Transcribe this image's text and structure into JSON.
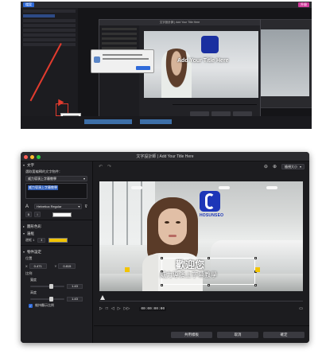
{
  "top_screenshot": {
    "tag": "檔案",
    "right_button": "升級",
    "dialog_title": "文字設計師 | Add Your Title Here",
    "stage_title": "Add Your Title Here",
    "alert_button": "確定"
  },
  "window": {
    "title": "文字設計師 | Add Your Title Here"
  },
  "left_panel": {
    "section_text": "文字",
    "prompt_label": "選取要編輯的文字物件：",
    "object_select": "威力導演上字幕教學",
    "text_content": "威力導演上字幕教學",
    "font_name": "Helvetica Regular",
    "bold_label": "B",
    "italic_label": "I",
    "font_color": "#ffffff",
    "section_fill": "圖形色彩",
    "section_border": "邊框",
    "border_label": "邊框 1",
    "border_color": "#f2c400",
    "section_object": "物件設定",
    "position_label": "位置",
    "x_label": "X",
    "x_value": "0.471",
    "y_label": "Y",
    "y_value": "0.815",
    "scale_label": "比例",
    "width_label": "寬度",
    "width_value": "1.43",
    "width_fraction": 0.55,
    "height_label": "高度",
    "height_value": "1.43",
    "height_fraction": 0.55,
    "keep_ratio_label": "維持顯示比例"
  },
  "right_panel": {
    "zoom_value": "檢視大小",
    "logo_text": "HOSUNSEO",
    "title_line1": "歡迎您",
    "title_line2": "威力導演上字幕教學",
    "timecode": "00:00:00:00"
  },
  "footer": {
    "share_button": "共用樣板",
    "cancel_button": "取消",
    "ok_button": "確定"
  },
  "colors": {
    "accent": "#2f6ad9",
    "highlight_yellow": "#f2c400",
    "arrow_red": "#e23b2e"
  }
}
